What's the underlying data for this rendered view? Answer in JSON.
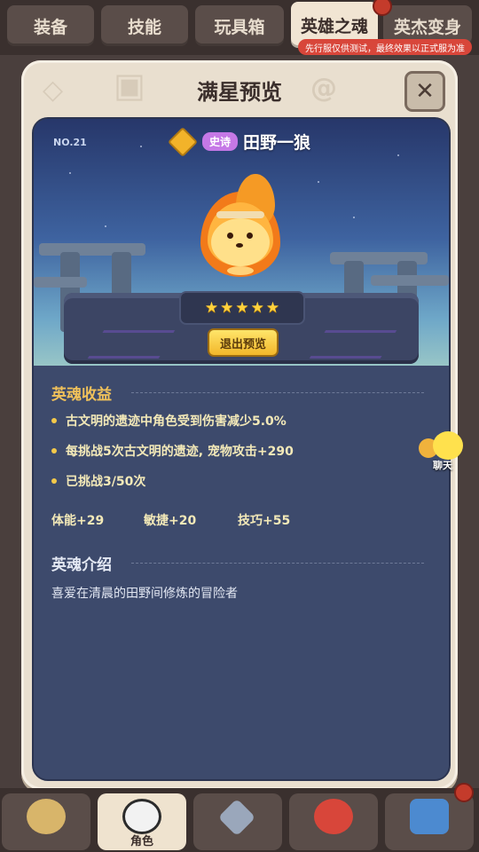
{
  "top_tabs": [
    {
      "label": "装备",
      "active": false
    },
    {
      "label": "技能",
      "active": false
    },
    {
      "label": "玩具箱",
      "active": false
    },
    {
      "label": "英雄之魂",
      "active": true
    },
    {
      "label": "英杰变身",
      "active": false
    }
  ],
  "test_notice": "先行服仅供测试，最终效果以正式服为准",
  "modal": {
    "title": "满星预览",
    "close_icon": "close-icon"
  },
  "hero": {
    "number": "NO.21",
    "rarity": "史诗",
    "name": "田野一狼",
    "stars": 5,
    "exit_preview_label": "退出预览"
  },
  "benefits": {
    "title": "英魂收益",
    "items": [
      "古文明的遗迹中角色受到伤害减少5.0%",
      "每挑战5次古文明的遗迹, 宠物攻击+290",
      "已挑战3/50次"
    ],
    "stats": [
      {
        "label": "体能+29"
      },
      {
        "label": "敏捷+20"
      },
      {
        "label": "技巧+55"
      }
    ]
  },
  "intro": {
    "title": "英魂介绍",
    "text": "喜爱在清晨的田野间修炼的冒险者"
  },
  "chat": {
    "label": "聊天"
  },
  "bottom_nav": [
    {
      "label": "",
      "icon": "hero-icon"
    },
    {
      "label": "角色",
      "icon": "character-icon",
      "active": true
    },
    {
      "label": "",
      "icon": "sword-icon"
    },
    {
      "label": "",
      "icon": "pet-icon"
    },
    {
      "label": "",
      "icon": "shop-icon"
    }
  ],
  "colors": {
    "accent_gold": "#f3c94a",
    "section_title": "#f0c15a",
    "rarity_purple": "#c578e6"
  }
}
